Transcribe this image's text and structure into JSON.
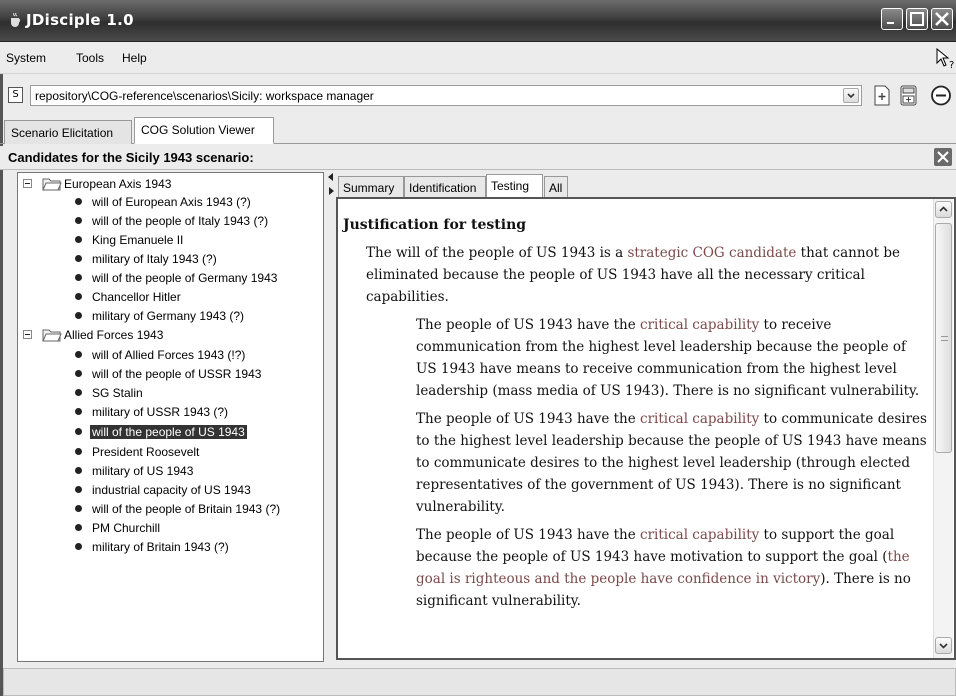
{
  "window": {
    "title": "JDisciple 1.0"
  },
  "menu": [
    "System",
    "Tools",
    "Help"
  ],
  "pathbar": {
    "doc_icon": "S",
    "path": "repository\\COG-reference\\scenarios\\Sicily: workspace manager"
  },
  "main_tabs": [
    {
      "label": "Scenario Elicitation",
      "active": false
    },
    {
      "label": "COG Solution Viewer",
      "active": true
    }
  ],
  "candidates_header": "Candidates for the Sicily 1943 scenario:",
  "tree": {
    "groups": [
      {
        "label": "European Axis 1943",
        "items": [
          "will of European Axis 1943 (?)",
          "will of the people of Italy 1943 (?)",
          "King Emanuele II",
          "military of Italy 1943 (?)",
          "will of the people of Germany 1943",
          "Chancellor Hitler",
          "military of Germany 1943 (?)"
        ]
      },
      {
        "label": "Allied Forces 1943",
        "items": [
          "will of Allied Forces 1943 (!?)",
          "will of the people of USSR 1943",
          "SG Stalin",
          "military of USSR 1943 (?)",
          "will of the people of US 1943",
          "President Roosevelt",
          "military of US 1943",
          "industrial capacity of US 1943",
          "will of the people of Britain 1943 (?)",
          "PM Churchill",
          "military of Britain 1943 (?)"
        ]
      }
    ],
    "selected": "will of the people of US 1943"
  },
  "detail_tabs": [
    {
      "label": "Summary",
      "active": false
    },
    {
      "label": "Identification",
      "active": false
    },
    {
      "label": "Testing",
      "active": true
    },
    {
      "label": "All",
      "active": false
    }
  ],
  "detail": {
    "heading": "Justification for testing",
    "intro": {
      "pre": "The will of the people of US 1943 is a ",
      "link": "strategic COG candidate",
      "post": " that cannot be eliminated because the people of US 1943 have all the necessary critical capabilities."
    },
    "capabilities": [
      {
        "pre": "The people of US 1943 have the ",
        "link": "critical capability",
        "post": " to receive communication from the highest level leadership because the people of US 1943 have means to receive communication from the highest level leadership (mass media of US 1943). There is no significant vulnerability."
      },
      {
        "pre": "The people of US 1943 have the ",
        "link": "critical capability",
        "post": " to communicate desires to the highest level leadership because the people of US 1943 have means to communicate desires to the highest level leadership (through elected representatives of the government of US 1943). There is no significant vulnerability."
      },
      {
        "pre": "The people of US 1943 have the ",
        "link": "critical capability",
        "mid": " to support the goal because the people of US 1943 have motivation to support the goal (",
        "link2": "the goal is righteous and the people have confidence in victory",
        "post": "). There is no significant vulnerability."
      }
    ]
  }
}
